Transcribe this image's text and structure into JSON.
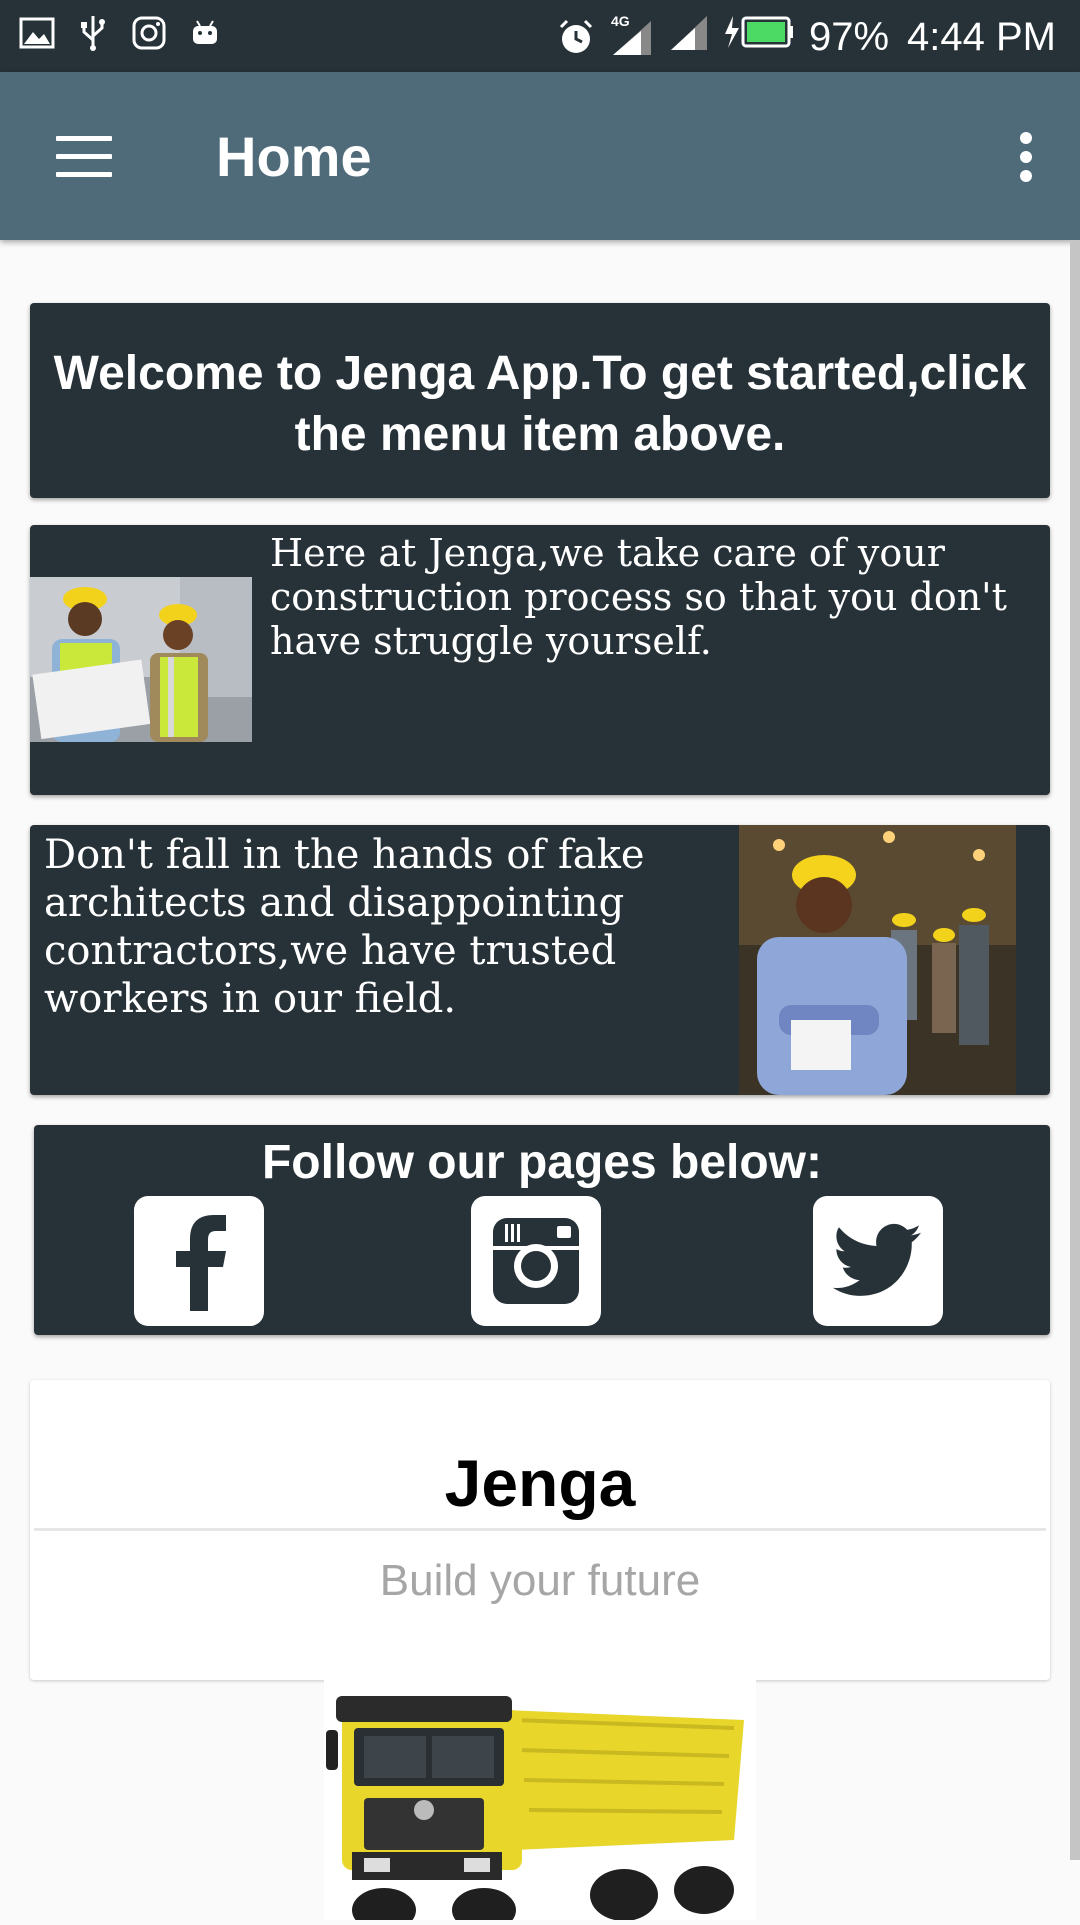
{
  "status_bar": {
    "battery": "97%",
    "time": "4:44 PM",
    "network": "4G"
  },
  "app_bar": {
    "title": "Home"
  },
  "welcome": {
    "text": "Welcome to Jenga App.To get started,click the menu item above."
  },
  "info_cards": [
    {
      "text": "Here at Jenga,we take care of your construction process so that you don't have struggle yourself."
    },
    {
      "text": "Don't fall in the hands of fake architects and disappointing contractors,we have trusted workers in our field."
    }
  ],
  "follow": {
    "title": "Follow our pages below:",
    "icons": [
      "facebook-icon",
      "instagram-icon",
      "twitter-icon"
    ]
  },
  "brand": {
    "title": "Jenga",
    "subtitle": "Build your future"
  },
  "colors": {
    "status_bar": "#263238",
    "app_bar": "#4f6b7a",
    "card_bg": "#263238",
    "battery": "#4cd964",
    "truck_yellow": "#e8d62a"
  }
}
